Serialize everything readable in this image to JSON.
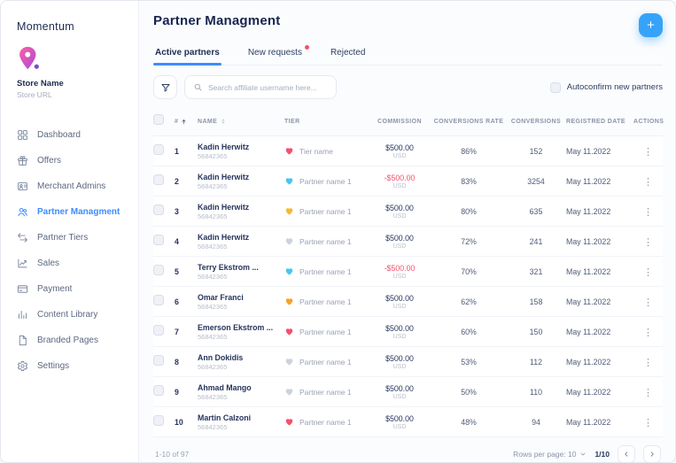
{
  "colors": {
    "accent": "#3e8bff",
    "add_button": "#36a3f9",
    "negative": "#f4516c"
  },
  "sidebar": {
    "logo_text": "Momentum",
    "pin_icon": "store-pin-icon",
    "store_name": "Store Name",
    "store_url": "Store URL",
    "items": [
      {
        "label": "Dashboard",
        "icon": "dashboard-icon",
        "active": false
      },
      {
        "label": "Offers",
        "icon": "offers-icon",
        "active": false
      },
      {
        "label": "Merchant Admins",
        "icon": "merchant-admins-icon",
        "active": false
      },
      {
        "label": "Partner Managment",
        "icon": "partner-managment-icon",
        "active": true
      },
      {
        "label": "Partner Tiers",
        "icon": "partner-tiers-icon",
        "active": false
      },
      {
        "label": "Sales",
        "icon": "sales-icon",
        "active": false
      },
      {
        "label": "Payment",
        "icon": "payment-icon",
        "active": false
      },
      {
        "label": "Content Library",
        "icon": "content-library-icon",
        "active": false
      },
      {
        "label": "Branded Pages",
        "icon": "branded-pages-icon",
        "active": false
      },
      {
        "label": "Settings",
        "icon": "settings-icon",
        "active": false
      }
    ]
  },
  "header": {
    "title": "Partner Managment",
    "add_button": "+"
  },
  "tabs": [
    {
      "label": "Active partners",
      "active": true,
      "dot": false
    },
    {
      "label": "New requests",
      "active": false,
      "dot": true
    },
    {
      "label": "Rejected",
      "active": false,
      "dot": false
    }
  ],
  "toolbar": {
    "filter_icon": "funnel-icon",
    "search_icon": "search-icon",
    "search_placeholder": "Search affiliate username here...",
    "autoconfirm_label": "Autoconfirm new partners",
    "autoconfirm_checked": false
  },
  "table": {
    "headers": {
      "num": "#",
      "name": "NAME",
      "tier": "TIER",
      "commission": "COMMISSION",
      "conversions_rate": "CONVERSIONS RATE",
      "conversions": "CONVERSIONS",
      "registred_date": "REGISTRED DATE",
      "actions": "ACTIONS"
    },
    "rows": [
      {
        "num": "1",
        "name": "Kadin Herwitz",
        "id": "56842365",
        "tier": "Tier name",
        "tier_color": "#f4516c",
        "commission": "$500.00",
        "currency": "USD",
        "negative": false,
        "rate": "86%",
        "conversions": "152",
        "date": "May 11.2022"
      },
      {
        "num": "2",
        "name": "Kadin Herwitz",
        "id": "56842365",
        "tier": "Partner name 1",
        "tier_color": "#45c7f1",
        "commission": "-$500.00",
        "currency": "USD",
        "negative": true,
        "rate": "83%",
        "conversions": "3254",
        "date": "May 11.2022"
      },
      {
        "num": "3",
        "name": "Kadin Herwitz",
        "id": "56842365",
        "tier": "Partner name 1",
        "tier_color": "#f7b731",
        "commission": "$500.00",
        "currency": "USD",
        "negative": false,
        "rate": "80%",
        "conversions": "635",
        "date": "May 11.2022"
      },
      {
        "num": "4",
        "name": "Kadin Herwitz",
        "id": "56842365",
        "tier": "Partner name 1",
        "tier_color": "#ccd2de",
        "commission": "$500.00",
        "currency": "USD",
        "negative": false,
        "rate": "72%",
        "conversions": "241",
        "date": "May 11.2022"
      },
      {
        "num": "5",
        "name": "Terry Ekstrom ...",
        "id": "56842365",
        "tier": "Partner name 1",
        "tier_color": "#45c7f1",
        "commission": "-$500.00",
        "currency": "USD",
        "negative": true,
        "rate": "70%",
        "conversions": "321",
        "date": "May 11.2022"
      },
      {
        "num": "6",
        "name": "Omar Franci",
        "id": "56842365",
        "tier": "Partner name 1",
        "tier_color": "#f7a325",
        "commission": "$500.00",
        "currency": "USD",
        "negative": false,
        "rate": "62%",
        "conversions": "158",
        "date": "May 11.2022"
      },
      {
        "num": "7",
        "name": "Emerson Ekstrom ...",
        "id": "56842365",
        "tier": "Partner name 1",
        "tier_color": "#f4516c",
        "commission": "$500.00",
        "currency": "USD",
        "negative": false,
        "rate": "60%",
        "conversions": "150",
        "date": "May 11.2022"
      },
      {
        "num": "8",
        "name": "Ann Dokidis",
        "id": "56842365",
        "tier": "Partner name 1",
        "tier_color": "#ccd2de",
        "commission": "$500.00",
        "currency": "USD",
        "negative": false,
        "rate": "53%",
        "conversions": "112",
        "date": "May 11.2022"
      },
      {
        "num": "9",
        "name": "Ahmad Mango",
        "id": "56842365",
        "tier": "Partner name 1",
        "tier_color": "#ccd2de",
        "commission": "$500.00",
        "currency": "USD",
        "negative": false,
        "rate": "50%",
        "conversions": "110",
        "date": "May 11.2022"
      },
      {
        "num": "10",
        "name": "Martin Calzoni",
        "id": "56842365",
        "tier": "Partner name 1",
        "tier_color": "#f4516c",
        "commission": "$500.00",
        "currency": "USD",
        "negative": false,
        "rate": "48%",
        "conversions": "94",
        "date": "May 11.2022"
      }
    ]
  },
  "pagination": {
    "range": "1-10 of 97",
    "rows_per_page": "Rows per page: 10",
    "page_indicator": "1/10",
    "prev_icon": "chevron-left-icon",
    "next_icon": "chevron-right-icon"
  }
}
